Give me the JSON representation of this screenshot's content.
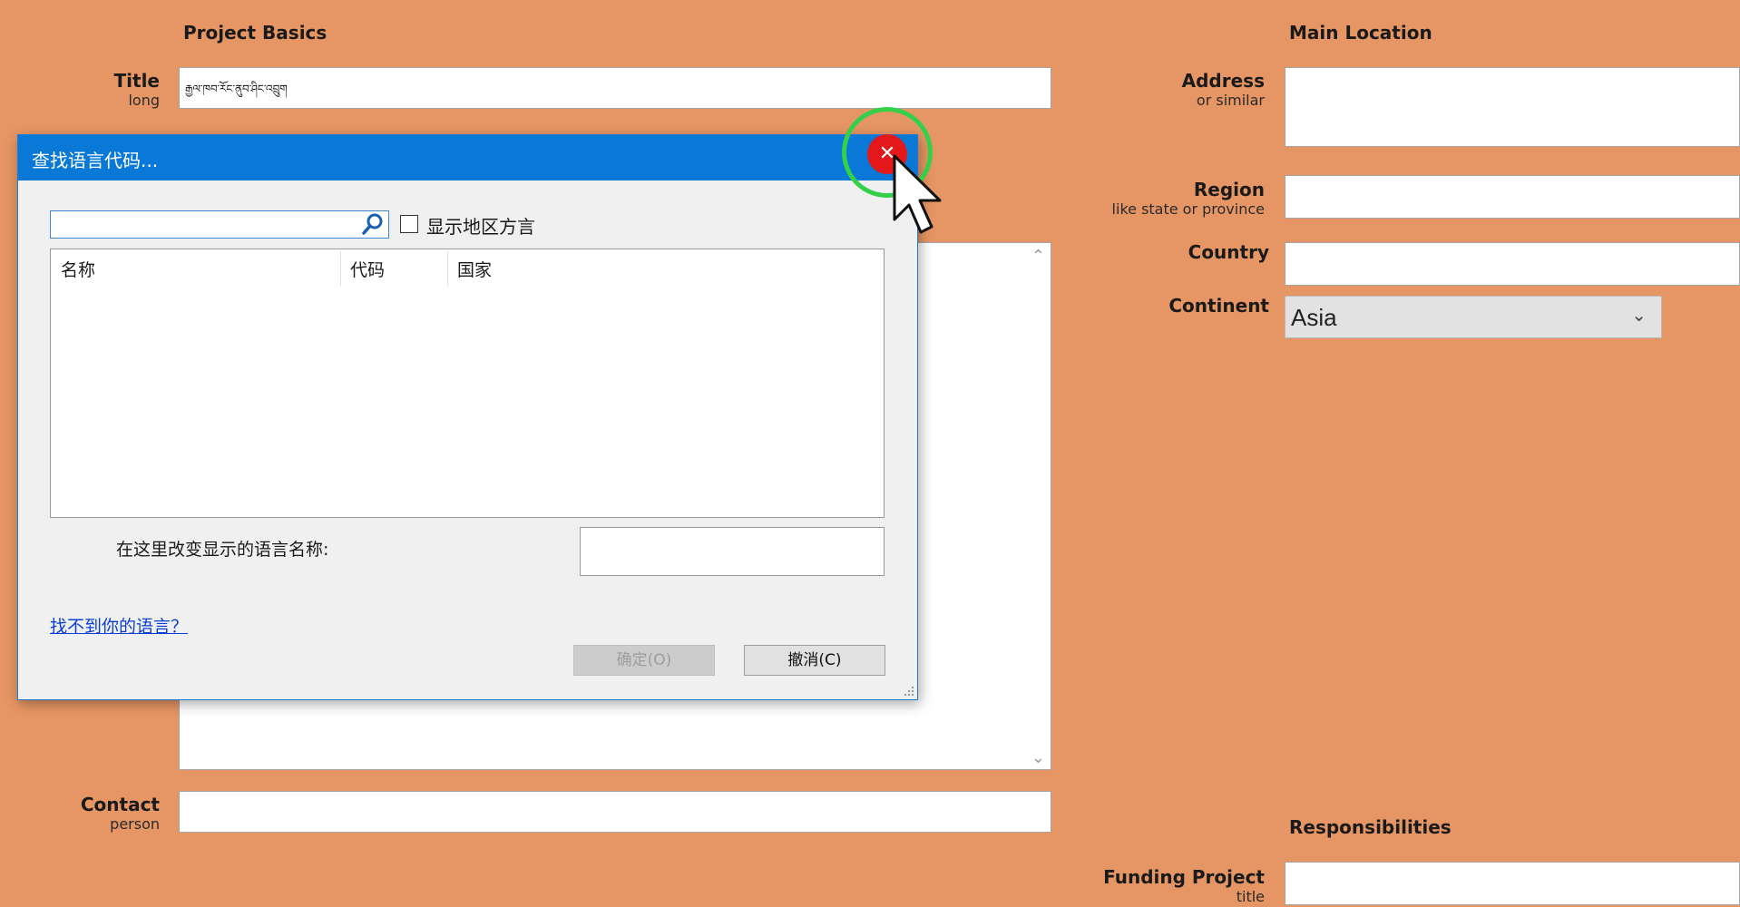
{
  "left_panel": {
    "heading": "Project Basics",
    "title_label": "Title",
    "title_sub": "long",
    "title_value": "རྒྱལ་ཁབ་རོང་ནུབ་ཤིང་འབྲུག",
    "contact_label": "Contact",
    "contact_sub": "person"
  },
  "right_panel": {
    "heading": "Main Location",
    "address_label": "Address",
    "address_sub": "or similar",
    "region_label": "Region",
    "region_sub": "like state or province",
    "country_label": "Country",
    "continent_label": "Continent",
    "continent_value": "Asia",
    "responsibilities_heading": "Responsibilities",
    "funding_label": "Funding Project",
    "funding_sub": "title"
  },
  "dialog": {
    "title": "查找语言代码...",
    "search_value": "",
    "show_dialects_label": "显示地区方言",
    "show_dialects_checked": false,
    "columns": [
      "名称",
      "代码",
      "国家"
    ],
    "rows": [],
    "rename_label": "在这里改变显示的语言名称:",
    "rename_value": "",
    "not_found_link": "找不到你的语言？",
    "ok_label": "确定(O)",
    "cancel_label": "撤消(C)",
    "close_symbol": "✕"
  },
  "colors": {
    "background": "#e69664",
    "titlebar": "#0a78d7",
    "highlight_ring": "#35d04a",
    "close_red": "#e4181a",
    "link": "#0a3fd6"
  }
}
